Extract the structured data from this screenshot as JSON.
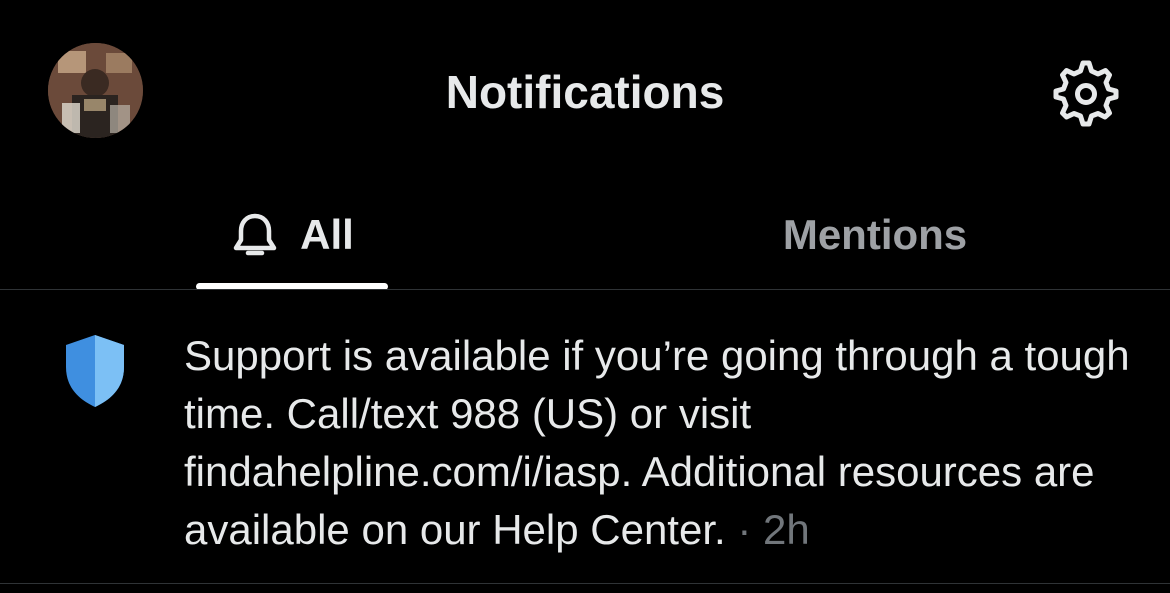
{
  "header": {
    "title": "Notifications",
    "avatar_icon": "profile-avatar",
    "settings_icon": "gear-icon"
  },
  "tabs": [
    {
      "label": "All",
      "icon": "bell-icon",
      "selected": true
    },
    {
      "label": "Mentions",
      "selected": false
    }
  ],
  "notification": {
    "icon": "shield-icon",
    "text": "Support is available if you’re going through a tough time. Call/text 988 (US) or visit findahelpline.com/i/iasp. Additional resources are available on our Help Center.",
    "separator": "·",
    "time": "2h"
  },
  "colors": {
    "background": "#000000",
    "text": "#e7e9ea",
    "muted": "#71767b",
    "inactive_tab": "#9ea1a5",
    "divider": "#2f3336",
    "shield_dark": "#3f8fe0",
    "shield_light": "#7cc0f5"
  }
}
